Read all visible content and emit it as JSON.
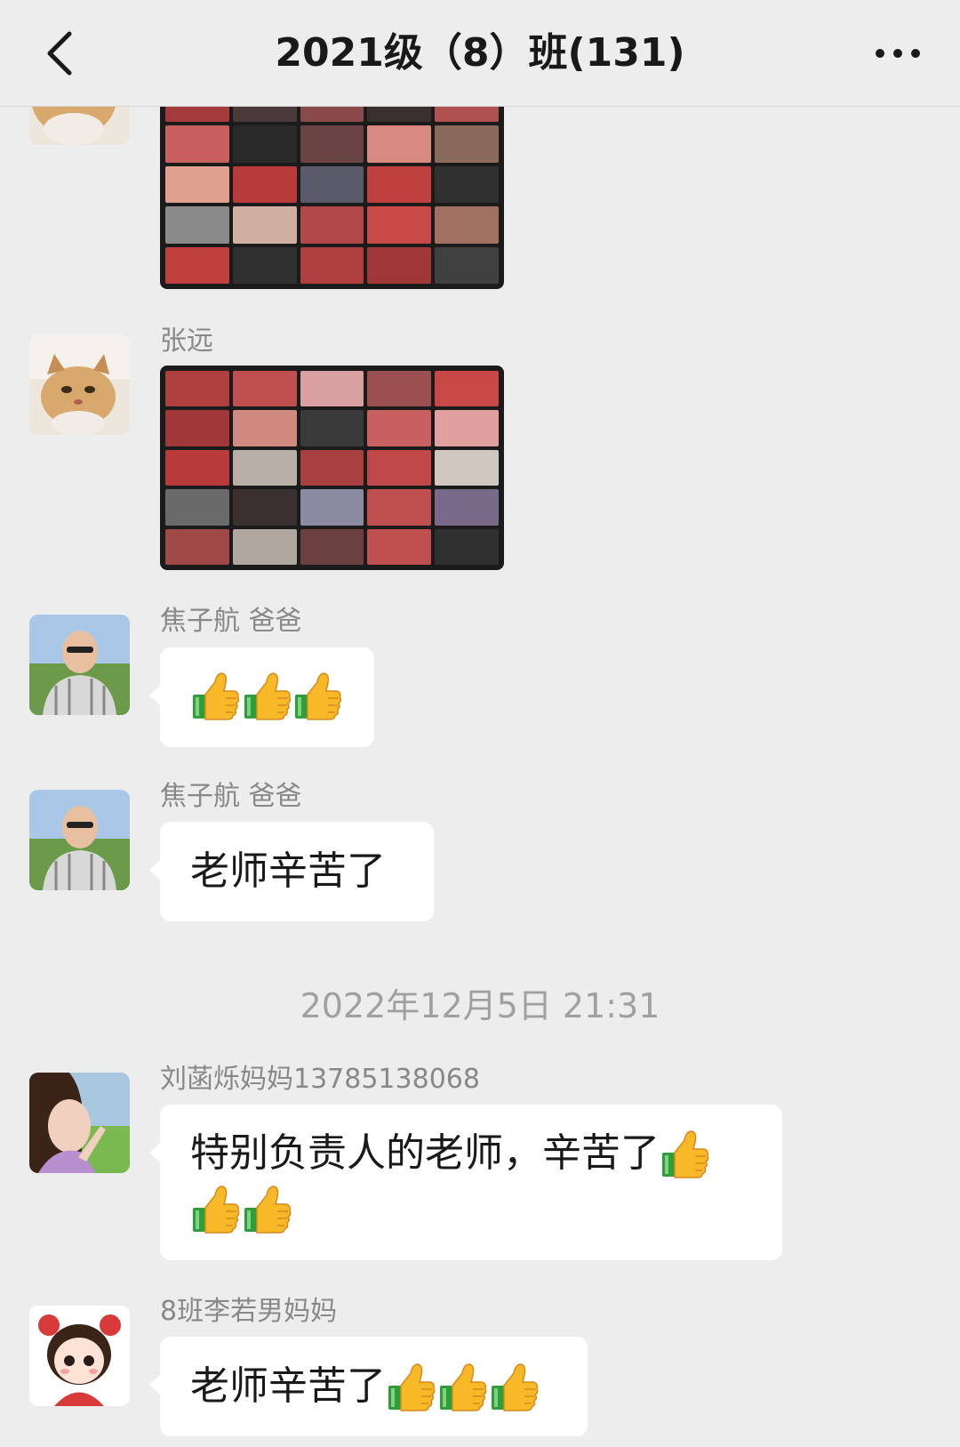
{
  "navbar": {
    "title": "2021级（8）班(131)",
    "back_icon": "chevron-left-icon",
    "more_icon": "ellipsis-icon"
  },
  "messages": [
    {
      "type": "image",
      "sender": ""
    },
    {
      "type": "image",
      "sender": "张远"
    },
    {
      "type": "emoji",
      "sender": "焦子航  爸爸",
      "emoji": [
        "thumbs-up",
        "thumbs-up",
        "thumbs-up"
      ]
    },
    {
      "type": "text",
      "sender": "焦子航  爸爸",
      "text": "老师辛苦了"
    },
    {
      "type": "text",
      "sender": "刘菡烁妈妈13785138068",
      "text": "特别负责人的老师，辛苦了",
      "emoji": [
        "thumbs-up",
        "thumbs-up",
        "thumbs-up"
      ]
    },
    {
      "type": "text",
      "sender": "8班李若男妈妈",
      "text": "老师辛苦了",
      "emoji": [
        "thumbs-up",
        "thumbs-up",
        "thumbs-up"
      ]
    }
  ],
  "timestamp": "2022年12月5日 21:31",
  "colors": {
    "background": "#ededed",
    "bubble": "#ffffff",
    "sender_name": "#888888",
    "timestamp": "#a0a0a0",
    "thumb_yellow": "#f7b928",
    "thumb_cuff": "#2e9e3a"
  }
}
